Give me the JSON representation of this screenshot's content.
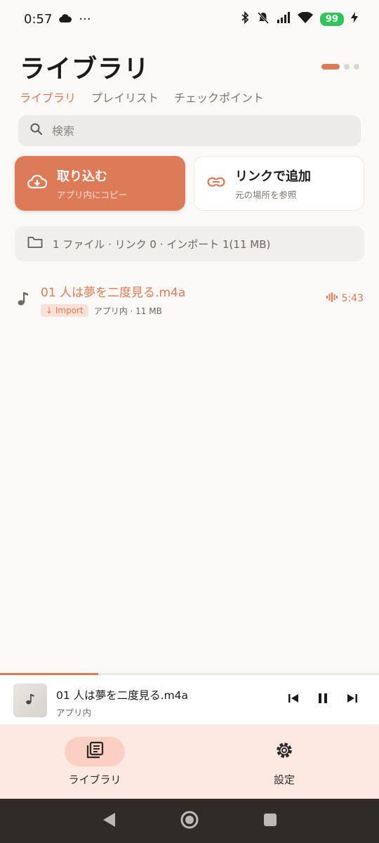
{
  "status_bar": {
    "time": "0:57",
    "more": "···",
    "battery": "99",
    "icons": [
      "cloud-icon",
      "bluetooth-icon",
      "mute-icon",
      "signal-icon",
      "wifi-icon",
      "charging-icon"
    ]
  },
  "header": {
    "title": "ライブラリ"
  },
  "tabs": [
    {
      "label": "ライブラリ",
      "active": true
    },
    {
      "label": "プレイリスト",
      "active": false
    },
    {
      "label": "チェックポイント",
      "active": false
    }
  ],
  "search": {
    "placeholder": "検索",
    "value": ""
  },
  "actions": {
    "import": {
      "title": "取り込む",
      "subtitle": "アプリ内にコピー",
      "icon": "cloud-download-icon"
    },
    "link": {
      "title": "リンクで追加",
      "subtitle": "元の場所を参照",
      "icon": "link-icon"
    }
  },
  "summary": {
    "text": "1 ファイル · リンク 0 · インポート 1(11 MB)",
    "icon": "folder-icon"
  },
  "tracks": [
    {
      "title": "01 人は夢を二度見る.m4a",
      "badge": "↓ Import",
      "meta": "アプリ内 · 11 MB",
      "duration": "5:43",
      "playing": true
    }
  ],
  "mini_player": {
    "title": "01 人は夢を二度見る.m4a",
    "subtitle": "アプリ内",
    "progress_fraction": 0.26
  },
  "bottom_nav": [
    {
      "label": "ライブラリ",
      "icon": "library-icon",
      "active": true
    },
    {
      "label": "設定",
      "icon": "gear-icon",
      "active": false
    }
  ],
  "colors": {
    "accent": "#dd7a58",
    "background": "#faf9f7",
    "nav_background": "#fde9e2"
  }
}
